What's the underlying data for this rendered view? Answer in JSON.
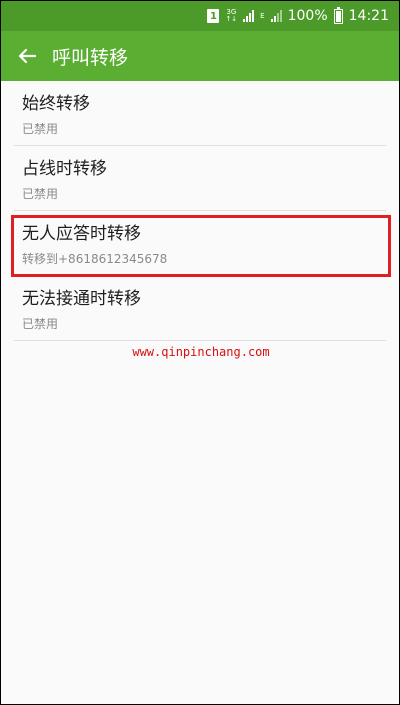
{
  "status": {
    "sim_slot": "1",
    "network_1": "3G",
    "network_2": "E",
    "battery": "100%",
    "battery_level": 1.0,
    "time": "14:21"
  },
  "appbar": {
    "title": "呼叫转移",
    "back_icon": "arrow-left-icon"
  },
  "items": [
    {
      "title": "始终转移",
      "subtitle": "已禁用"
    },
    {
      "title": "占线时转移",
      "subtitle": "已禁用"
    },
    {
      "title": "无人应答时转移",
      "subtitle": "转移到+8618612345678",
      "highlighted": true
    },
    {
      "title": "无法接通时转移",
      "subtitle": "已禁用"
    }
  ],
  "watermark": "www.qinpinchang.com",
  "colors": {
    "statusbar": "#4c9a2a",
    "appbar": "#5aae32",
    "highlight": "#e02020"
  }
}
